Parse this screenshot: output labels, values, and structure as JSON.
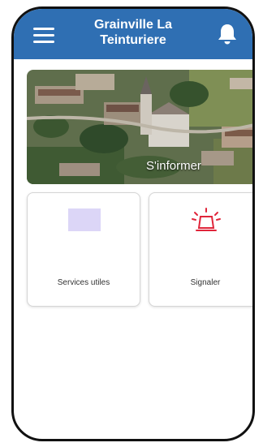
{
  "header": {
    "title": "Grainville La\nTeinturiere",
    "menu_icon": "hamburger-menu-icon",
    "notification_icon": "bell-icon",
    "background_color": "#2f6fb3"
  },
  "banner": {
    "label": "S'informer",
    "image": "aerial-village-photo"
  },
  "tiles": [
    {
      "label": "Services utiles",
      "icon": "services-icon",
      "icon_color": "#dcd6f7"
    },
    {
      "label": "Signaler",
      "icon": "siren-alarm-icon",
      "icon_color": "#e0253a"
    }
  ]
}
